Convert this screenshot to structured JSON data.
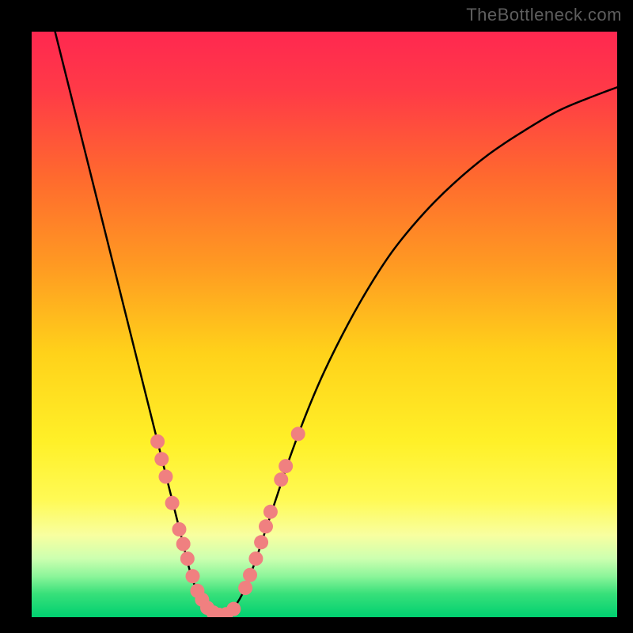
{
  "watermark": "TheBottleneck.com",
  "chart_data": {
    "type": "line",
    "title": "",
    "xlabel": "",
    "ylabel": "",
    "xlim": [
      0,
      100
    ],
    "ylim": [
      0,
      100
    ],
    "background_gradient": {
      "direction": "vertical",
      "stops": [
        {
          "offset": 0.0,
          "color": "#ff2850"
        },
        {
          "offset": 0.1,
          "color": "#ff3a47"
        },
        {
          "offset": 0.25,
          "color": "#ff6a2e"
        },
        {
          "offset": 0.4,
          "color": "#ff9a22"
        },
        {
          "offset": 0.55,
          "color": "#ffd21a"
        },
        {
          "offset": 0.7,
          "color": "#fff028"
        },
        {
          "offset": 0.8,
          "color": "#fffa55"
        },
        {
          "offset": 0.86,
          "color": "#f8ffa0"
        },
        {
          "offset": 0.9,
          "color": "#ccffb0"
        },
        {
          "offset": 0.93,
          "color": "#8cf59a"
        },
        {
          "offset": 0.96,
          "color": "#38e07a"
        },
        {
          "offset": 1.0,
          "color": "#00d070"
        }
      ]
    },
    "series": [
      {
        "name": "bottleneck-curve-left",
        "stroke": "#000000",
        "stroke_width": 2.5,
        "points": [
          {
            "x": 4.0,
            "y": 100.0
          },
          {
            "x": 6.0,
            "y": 92.0
          },
          {
            "x": 8.0,
            "y": 84.0
          },
          {
            "x": 10.0,
            "y": 76.0
          },
          {
            "x": 12.0,
            "y": 68.0
          },
          {
            "x": 14.0,
            "y": 60.0
          },
          {
            "x": 16.0,
            "y": 52.0
          },
          {
            "x": 18.0,
            "y": 44.0
          },
          {
            "x": 20.0,
            "y": 36.0
          },
          {
            "x": 21.5,
            "y": 30.0
          },
          {
            "x": 23.0,
            "y": 24.0
          },
          {
            "x": 24.0,
            "y": 20.0
          },
          {
            "x": 25.0,
            "y": 16.0
          },
          {
            "x": 26.0,
            "y": 12.0
          },
          {
            "x": 27.0,
            "y": 8.0
          },
          {
            "x": 28.0,
            "y": 5.0
          },
          {
            "x": 29.0,
            "y": 3.0
          },
          {
            "x": 30.0,
            "y": 1.5
          },
          {
            "x": 31.0,
            "y": 0.7
          },
          {
            "x": 32.5,
            "y": 0.3
          }
        ]
      },
      {
        "name": "bottleneck-curve-right",
        "stroke": "#000000",
        "stroke_width": 2.5,
        "points": [
          {
            "x": 32.5,
            "y": 0.3
          },
          {
            "x": 34.0,
            "y": 1.0
          },
          {
            "x": 36.0,
            "y": 4.0
          },
          {
            "x": 38.0,
            "y": 9.0
          },
          {
            "x": 40.0,
            "y": 15.0
          },
          {
            "x": 42.0,
            "y": 21.0
          },
          {
            "x": 44.0,
            "y": 27.0
          },
          {
            "x": 47.0,
            "y": 35.0
          },
          {
            "x": 50.0,
            "y": 42.0
          },
          {
            "x": 54.0,
            "y": 50.0
          },
          {
            "x": 58.0,
            "y": 57.0
          },
          {
            "x": 62.0,
            "y": 63.0
          },
          {
            "x": 67.0,
            "y": 69.0
          },
          {
            "x": 72.0,
            "y": 74.0
          },
          {
            "x": 78.0,
            "y": 79.0
          },
          {
            "x": 84.0,
            "y": 83.0
          },
          {
            "x": 90.0,
            "y": 86.5
          },
          {
            "x": 96.0,
            "y": 89.0
          },
          {
            "x": 100.0,
            "y": 90.5
          }
        ]
      }
    ],
    "markers": {
      "name": "highlight-dots",
      "fill": "#f08080",
      "radius": 9,
      "points": [
        {
          "x": 21.5,
          "y": 30.0
        },
        {
          "x": 22.2,
          "y": 27.0
        },
        {
          "x": 22.9,
          "y": 24.0
        },
        {
          "x": 24.0,
          "y": 19.5
        },
        {
          "x": 25.2,
          "y": 15.0
        },
        {
          "x": 25.9,
          "y": 12.5
        },
        {
          "x": 26.6,
          "y": 10.0
        },
        {
          "x": 27.5,
          "y": 7.0
        },
        {
          "x": 28.3,
          "y": 4.5
        },
        {
          "x": 29.1,
          "y": 3.0
        },
        {
          "x": 30.0,
          "y": 1.6
        },
        {
          "x": 31.0,
          "y": 0.8
        },
        {
          "x": 32.0,
          "y": 0.4
        },
        {
          "x": 33.2,
          "y": 0.5
        },
        {
          "x": 34.5,
          "y": 1.4
        },
        {
          "x": 36.5,
          "y": 5.0
        },
        {
          "x": 37.3,
          "y": 7.2
        },
        {
          "x": 38.3,
          "y": 10.0
        },
        {
          "x": 39.2,
          "y": 12.8
        },
        {
          "x": 40.0,
          "y": 15.5
        },
        {
          "x": 40.8,
          "y": 18.0
        },
        {
          "x": 42.6,
          "y": 23.5
        },
        {
          "x": 43.4,
          "y": 25.8
        },
        {
          "x": 45.5,
          "y": 31.3
        }
      ]
    }
  }
}
